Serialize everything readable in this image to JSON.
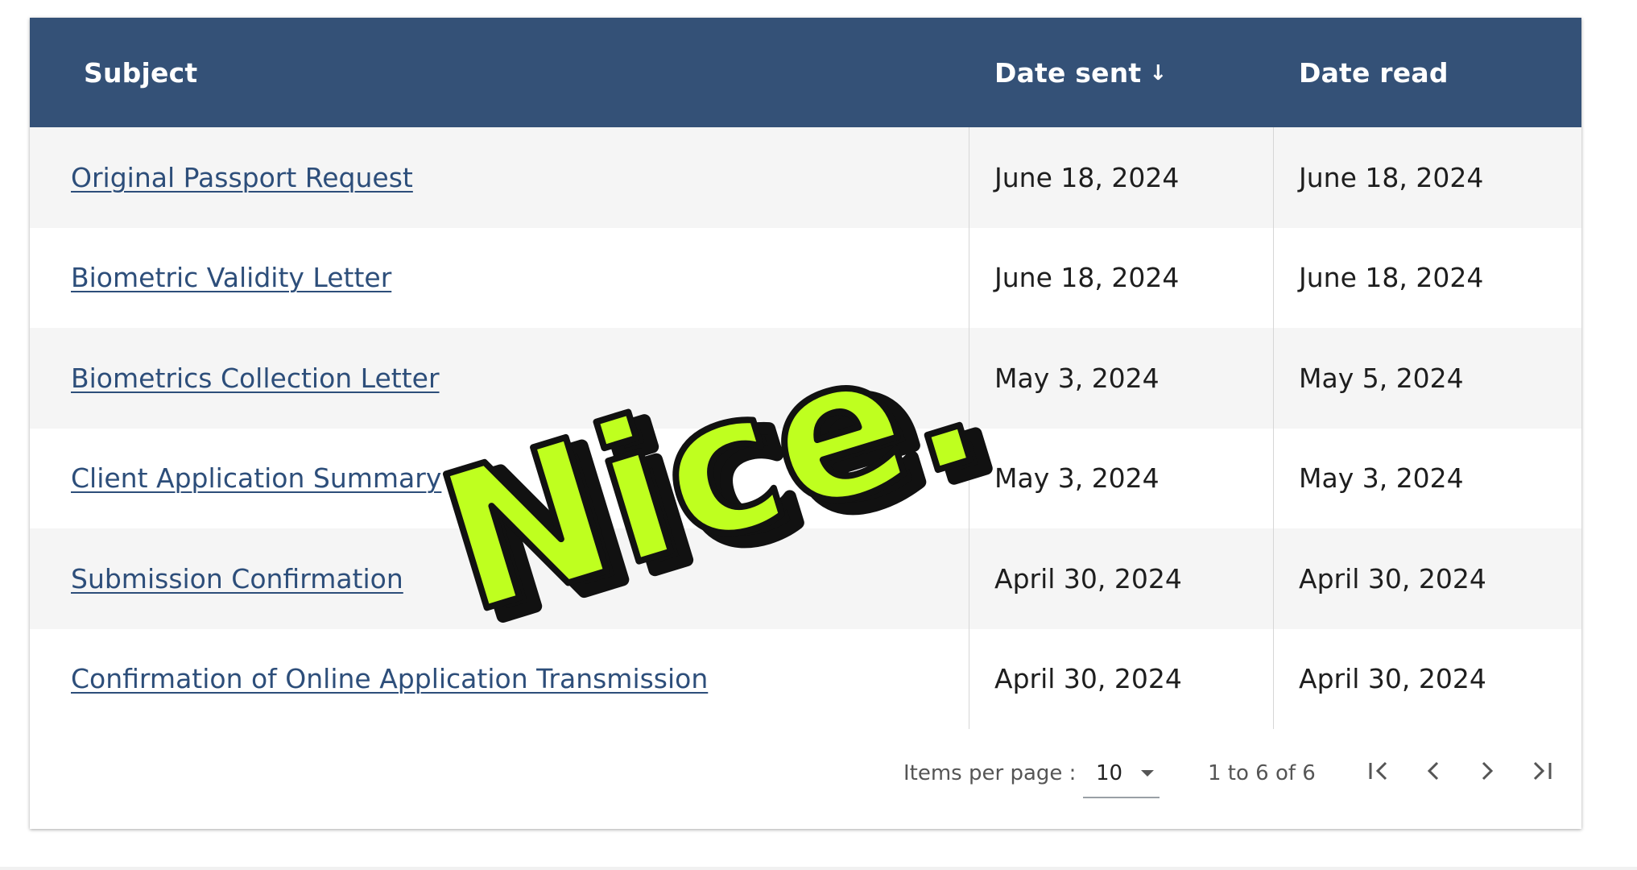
{
  "table": {
    "headers": {
      "subject": "Subject",
      "date_sent": "Date sent",
      "date_read": "Date read",
      "sort_indicator": "↓"
    },
    "rows": [
      {
        "subject": "Original Passport Request",
        "date_sent": "June 18, 2024",
        "date_read": "June 18, 2024"
      },
      {
        "subject": "Biometric Validity Letter",
        "date_sent": "June 18, 2024",
        "date_read": "June 18, 2024"
      },
      {
        "subject": "Biometrics Collection Letter",
        "date_sent": "May 3, 2024",
        "date_read": "May 5, 2024"
      },
      {
        "subject": "Client Application Summary",
        "date_sent": "May 3, 2024",
        "date_read": "May 3, 2024"
      },
      {
        "subject": "Submission Confirmation",
        "date_sent": "April 30, 2024",
        "date_read": "April 30, 2024"
      },
      {
        "subject": "Confirmation of Online Application Transmission",
        "date_sent": "April 30, 2024",
        "date_read": "April 30, 2024"
      }
    ]
  },
  "paginator": {
    "items_per_page_label": "Items per page :",
    "items_per_page_value": "10",
    "range_label": "1 to 6 of 6"
  },
  "icons": {
    "sort": "arrow-down-icon",
    "first": "first-page-icon",
    "prev": "chevron-left-icon",
    "next": "chevron-right-icon",
    "last": "last-page-icon",
    "dropdown": "caret-down-icon"
  },
  "sticker": {
    "text": "Nice."
  },
  "colors": {
    "header_bg": "#345177",
    "link": "#2d4e7a",
    "stripe": "#f5f5f5",
    "sticker_fill": "#bfff1f",
    "sticker_shadow": "#111111"
  }
}
